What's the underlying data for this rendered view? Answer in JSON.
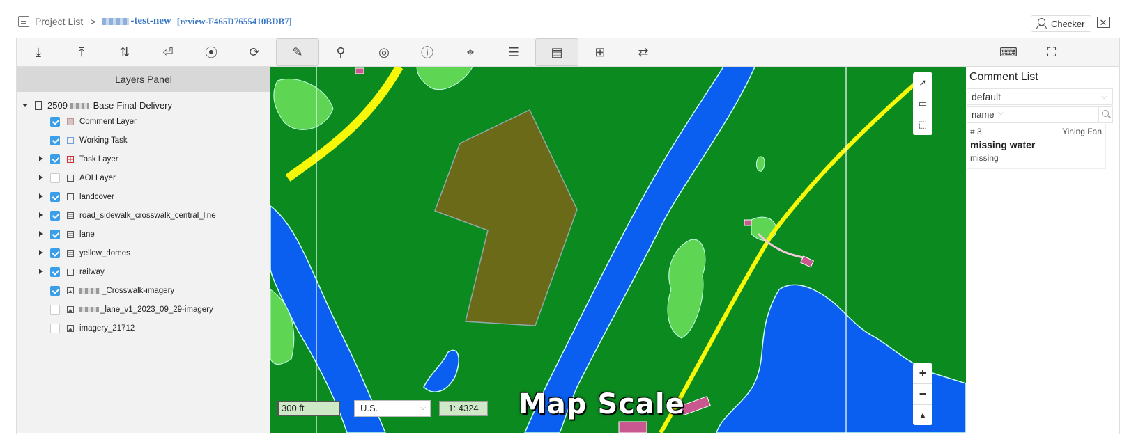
{
  "header": {
    "breadcrumb_root": "Project List",
    "breadcrumb_sep": ">",
    "project_name": "-test-new",
    "review_id": "[review-F465D7655410BDB7]",
    "role_label": "Checker",
    "close_label": "✕"
  },
  "toolbar": {
    "items": [
      {
        "icon": "download-icon",
        "glyph": "⤓"
      },
      {
        "icon": "upload-icon",
        "glyph": "⤒"
      },
      {
        "icon": "upload-download-icon",
        "glyph": "⇅"
      },
      {
        "icon": "return-icon",
        "glyph": "⏎"
      },
      {
        "icon": "screenshot-icon",
        "glyph": "⦿"
      },
      {
        "icon": "refresh-icon",
        "glyph": "⟳"
      },
      {
        "icon": "comment-edit-icon",
        "glyph": "✎"
      },
      {
        "icon": "search-icon",
        "glyph": "⚲"
      },
      {
        "icon": "locate-icon",
        "glyph": "◎"
      },
      {
        "icon": "info-cursor-icon",
        "glyph": "ⓘ"
      },
      {
        "icon": "map-pin-icon",
        "glyph": "⌖"
      },
      {
        "icon": "comment-list-icon",
        "glyph": "☰"
      },
      {
        "icon": "comment-panel-icon",
        "glyph": "▤"
      },
      {
        "icon": "add-box-icon",
        "glyph": "⊞"
      },
      {
        "icon": "swap-icon",
        "glyph": "⇄"
      },
      {
        "icon": "keyboard-icon",
        "glyph": "⌨"
      },
      {
        "icon": "fullscreen-icon",
        "glyph": "⛶"
      }
    ]
  },
  "layers_panel": {
    "title": "Layers Panel",
    "root": "2509-",
    "root_suffix": "-Base-Final-Delivery",
    "layers": [
      {
        "label": "Comment Layer",
        "checked": true,
        "expandable": false,
        "icon": "comment"
      },
      {
        "label": "Working Task",
        "checked": true,
        "expandable": false,
        "icon": "task"
      },
      {
        "label": "Task Layer",
        "checked": true,
        "expandable": true,
        "icon": "grid"
      },
      {
        "label": "AOI Layer",
        "checked": false,
        "expandable": true,
        "icon": "aoi"
      },
      {
        "label": "landcover",
        "checked": true,
        "expandable": true,
        "icon": "vec"
      },
      {
        "label": "road_sidewalk_crosswalk_central_line",
        "checked": true,
        "expandable": true,
        "icon": "vec"
      },
      {
        "label": "lane",
        "checked": true,
        "expandable": true,
        "icon": "vec"
      },
      {
        "label": "yellow_domes",
        "checked": true,
        "expandable": true,
        "icon": "vec"
      },
      {
        "label": "railway",
        "checked": true,
        "expandable": true,
        "icon": "vec"
      },
      {
        "label": "_Crosswalk-imagery",
        "checked": true,
        "expandable": false,
        "icon": "img"
      },
      {
        "label": "_lane_v1_2023_09_29-imagery",
        "checked": false,
        "expandable": false,
        "icon": "img"
      },
      {
        "label": "imagery_21712",
        "checked": false,
        "expandable": false,
        "icon": "img"
      }
    ]
  },
  "map": {
    "scale_distance": "300 ft",
    "unit_system": "U.S.",
    "scale_ratio": "1: 4324",
    "overlay_caption": "Map Scale",
    "zoom_in": "+",
    "zoom_out": "−",
    "reset_north": "▲",
    "colors": {
      "land": "#0a8a1f",
      "water": "#0a5ff0",
      "vegetation": "#5ed653",
      "road": "#f7f70a",
      "polygon": "#6b6a18"
    }
  },
  "comments": {
    "title": "Comment List",
    "filter_value": "default",
    "field_value": "name",
    "search_placeholder": "",
    "items": [
      {
        "number": "# 3",
        "author": "Yining Fan",
        "title": "missing water",
        "body": "missing"
      }
    ]
  }
}
